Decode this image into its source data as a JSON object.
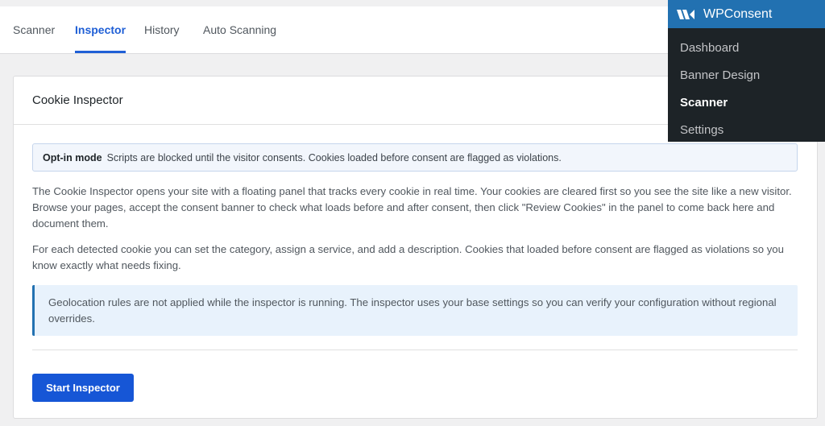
{
  "tabs": [
    {
      "label": "Scanner",
      "active": false
    },
    {
      "label": "Inspector",
      "active": true
    },
    {
      "label": "History",
      "active": false
    },
    {
      "label": "Auto Scanning",
      "active": false
    }
  ],
  "card": {
    "title": "Cookie Inspector",
    "mode": {
      "label": "Opt-in mode",
      "text": "Scripts are blocked until the visitor consents. Cookies loaded before consent are flagged as violations."
    },
    "paragraph1": "The Cookie Inspector opens your site with a floating panel that tracks every cookie in real time. Your cookies are cleared first so you see the site like a new visitor. Browse your pages, accept the consent banner to check what loads before and after consent, then click \"Review Cookies\" in the panel to come back here and document them.",
    "paragraph2": "For each detected cookie you can set the category, assign a service, and add a description. Cookies that loaded before consent are flagged as violations so you know exactly what needs fixing.",
    "notice": "Geolocation rules are not applied while the inspector is running. The inspector uses your base settings so you can verify your configuration without regional overrides.",
    "button_label": "Start Inspector"
  },
  "admin_menu": {
    "title": "WPConsent",
    "items": [
      {
        "label": "Dashboard",
        "current": false
      },
      {
        "label": "Banner Design",
        "current": false
      },
      {
        "label": "Scanner",
        "current": true
      },
      {
        "label": "Settings",
        "current": false
      }
    ]
  },
  "colors": {
    "accent": "#1f5fd6",
    "button": "#1656d6",
    "admin_bar": "#1d2327",
    "admin_head": "#2271b1",
    "notice_border": "#2271b1"
  }
}
